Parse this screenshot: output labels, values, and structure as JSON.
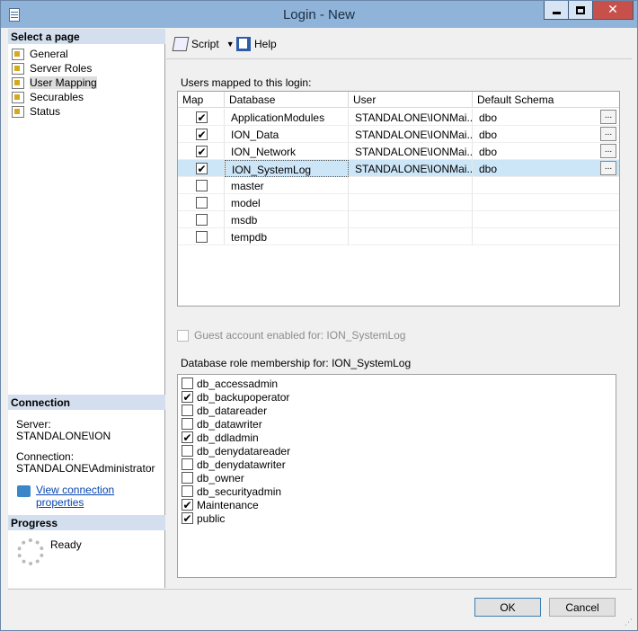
{
  "window": {
    "title": "Login - New",
    "close_glyph": "✕"
  },
  "left_pane": {
    "select_page_header": "Select a page",
    "pages": [
      {
        "label": "General",
        "icon": "wrench-page-icon"
      },
      {
        "label": "Server Roles",
        "icon": "wrench-page-icon"
      },
      {
        "label": "User Mapping",
        "icon": "wrench-page-icon",
        "selected": true
      },
      {
        "label": "Securables",
        "icon": "wrench-page-icon"
      },
      {
        "label": "Status",
        "icon": "wrench-page-icon"
      }
    ],
    "connection_header": "Connection",
    "server_label": "Server:",
    "server_value": "STANDALONE\\ION",
    "connection_label": "Connection:",
    "connection_value": "STANDALONE\\Administrator",
    "view_connection_link": "View connection properties",
    "progress_header": "Progress",
    "progress_status": "Ready"
  },
  "toolbar": {
    "script_label": "Script",
    "help_label": "Help",
    "dropdown_glyph": "▼"
  },
  "mapping": {
    "label": "Users mapped to this login:",
    "columns": [
      "Map",
      "Database",
      "User",
      "Default Schema"
    ],
    "rows": [
      {
        "checked": true,
        "database": "ApplicationModules",
        "user": "STANDALONE\\IONMai...",
        "schema": "dbo",
        "has_button": true
      },
      {
        "checked": true,
        "database": "ION_Data",
        "user": "STANDALONE\\IONMai...",
        "schema": "dbo",
        "has_button": true
      },
      {
        "checked": true,
        "database": "ION_Network",
        "user": "STANDALONE\\IONMai...",
        "schema": "dbo",
        "has_button": true
      },
      {
        "checked": true,
        "database": "ION_SystemLog",
        "user": "STANDALONE\\IONMai...",
        "schema": "dbo",
        "has_button": true,
        "selected": true
      },
      {
        "checked": false,
        "database": "master",
        "user": "",
        "schema": "",
        "has_button": false
      },
      {
        "checked": false,
        "database": "model",
        "user": "",
        "schema": "",
        "has_button": false
      },
      {
        "checked": false,
        "database": "msdb",
        "user": "",
        "schema": "",
        "has_button": false
      },
      {
        "checked": false,
        "database": "tempdb",
        "user": "",
        "schema": "",
        "has_button": false
      }
    ],
    "ellipsis": "...",
    "check_glyph": "✔"
  },
  "guest": {
    "label": "Guest account enabled for: ION_SystemLog",
    "checked": false
  },
  "roles": {
    "label": "Database role membership for: ION_SystemLog",
    "items": [
      {
        "label": "db_accessadmin",
        "checked": false
      },
      {
        "label": "db_backupoperator",
        "checked": true
      },
      {
        "label": "db_datareader",
        "checked": false
      },
      {
        "label": "db_datawriter",
        "checked": false
      },
      {
        "label": "db_ddladmin",
        "checked": true
      },
      {
        "label": "db_denydatareader",
        "checked": false
      },
      {
        "label": "db_denydatawriter",
        "checked": false
      },
      {
        "label": "db_owner",
        "checked": false
      },
      {
        "label": "db_securityadmin",
        "checked": false
      },
      {
        "label": "Maintenance",
        "checked": true
      },
      {
        "label": "public",
        "checked": true
      }
    ]
  },
  "footer": {
    "ok_label": "OK",
    "cancel_label": "Cancel"
  }
}
